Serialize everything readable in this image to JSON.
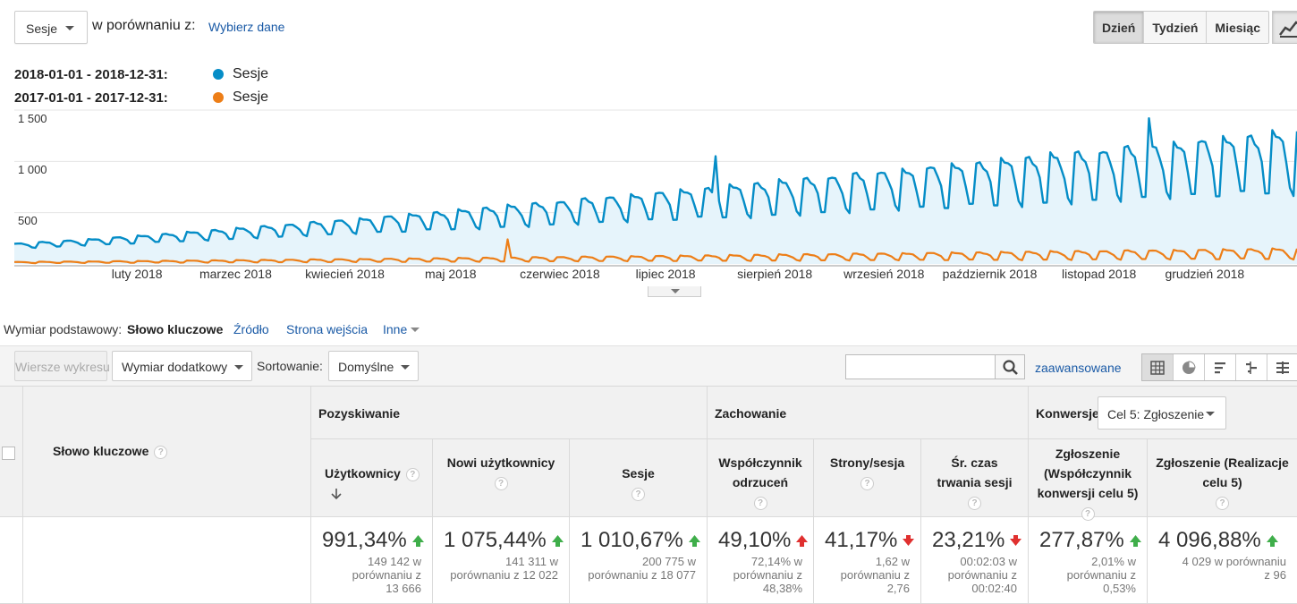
{
  "header": {
    "metric_select": "Sesje",
    "compare_label": "w porównaniu z:",
    "compare_link": "Wybierz dane",
    "periods": [
      "Dzień",
      "Tydzień",
      "Miesiąc"
    ],
    "active_period": "Dzień"
  },
  "legend": [
    {
      "range": "2018-01-01 - 2018-12-31:",
      "name": "Sesje",
      "color": "#058dc7"
    },
    {
      "range": "2017-01-01 - 2017-12-31:",
      "name": "Sesje",
      "color": "#ed7e17"
    }
  ],
  "chart_data": {
    "type": "area",
    "ylim": [
      0,
      1500
    ],
    "yticks": [
      "1 500",
      "1 000",
      "500"
    ],
    "yticks_values": [
      1500,
      1000,
      500
    ],
    "xlabels": [
      "luty 2018",
      "marzec 2018",
      "kwiecień 2018",
      "maj 2018",
      "czerwiec 2018",
      "lipiec 2018",
      "sierpień 2018",
      "wrzesień 2018",
      "październik 2018",
      "listopad 2018",
      "grudzień 2018"
    ],
    "xlabel_days": [
      31,
      59,
      90,
      120,
      151,
      181,
      212,
      243,
      273,
      304,
      334
    ],
    "days": 365,
    "series": [
      {
        "name": "Sesje",
        "period": "2018-01-01 - 2018-12-31",
        "color": "#058dc7",
        "fill": "#e6f4fb",
        "weekday_peak_start": 200,
        "weekday_peak_end": 1300,
        "weekend_low_start": 150,
        "weekend_low_end": 700,
        "spikes": [
          {
            "day": 199,
            "value": 1050
          },
          {
            "day": 322,
            "value": 1420
          }
        ]
      },
      {
        "name": "Sesje",
        "period": "2017-01-01 - 2017-12-31",
        "color": "#ed7e17",
        "weekday_peak_start": 20,
        "weekday_peak_end": 150,
        "weekend_low_start": 8,
        "weekend_low_end": 50,
        "spikes": [
          {
            "day": 140,
            "value": 240
          }
        ]
      }
    ]
  },
  "dimensions": {
    "label": "Wymiar podstawowy:",
    "items": [
      "Słowo kluczowe",
      "Źródło",
      "Strona wejścia",
      "Inne"
    ],
    "active": "Słowo kluczowe"
  },
  "toolbar": {
    "plot_rows": "Wiersze wykresu",
    "secondary_dim": "Wymiar dodatkowy",
    "sort_label": "Sortowanie:",
    "sort_value": "Domyślne",
    "advanced": "zaawansowane",
    "views": [
      "table-view-icon",
      "pie-view-icon",
      "bar-view-icon",
      "comparison-view-icon",
      "pivot-view-icon"
    ]
  },
  "table": {
    "keyword_header": "Słowo kluczowe",
    "groups": {
      "acquisition": "Pozyskiwanie",
      "behavior": "Zachowanie",
      "conversions": "Konwersje"
    },
    "conversion_goal": "Cel 5: Zgłoszenie",
    "columns": [
      {
        "title": "Użytkownicy",
        "big": "991,34%",
        "dir": "up",
        "sub": [
          "149 142 w",
          "porównaniu z",
          "13 666"
        ]
      },
      {
        "title": "Nowi użytkownicy",
        "big": "1 075,44%",
        "dir": "up",
        "sub": [
          "141 311 w",
          "porównaniu z 12 022"
        ]
      },
      {
        "title": "Sesje",
        "big": "1 010,67%",
        "dir": "up",
        "sub": [
          "200 775 w",
          "porównaniu z 18 077"
        ]
      },
      {
        "title": "Współczynnik odrzuceń",
        "big": "49,10%",
        "dir": "up-red",
        "sub": [
          "72,14% w",
          "porównaniu z",
          "48,38%"
        ]
      },
      {
        "title": "Strony/sesja",
        "big": "41,17%",
        "dir": "down",
        "sub": [
          "1,62 w",
          "porównaniu z",
          "2,76"
        ]
      },
      {
        "title": "Śr. czas trwania sesji",
        "big": "23,21%",
        "dir": "down",
        "sub": [
          "00:02:03 w",
          "porównaniu z",
          "00:02:40"
        ]
      },
      {
        "title": "Zgłoszenie (Współczynnik konwersji celu 5)",
        "big": "277,87%",
        "dir": "up",
        "sub": [
          "2,01% w",
          "porównaniu z",
          "0,53%"
        ]
      },
      {
        "title": "Zgłoszenie (Realizacje celu 5)",
        "big": "4 096,88%",
        "dir": "up",
        "sub": [
          "4 029 w porównaniu",
          "z 96"
        ]
      }
    ]
  }
}
